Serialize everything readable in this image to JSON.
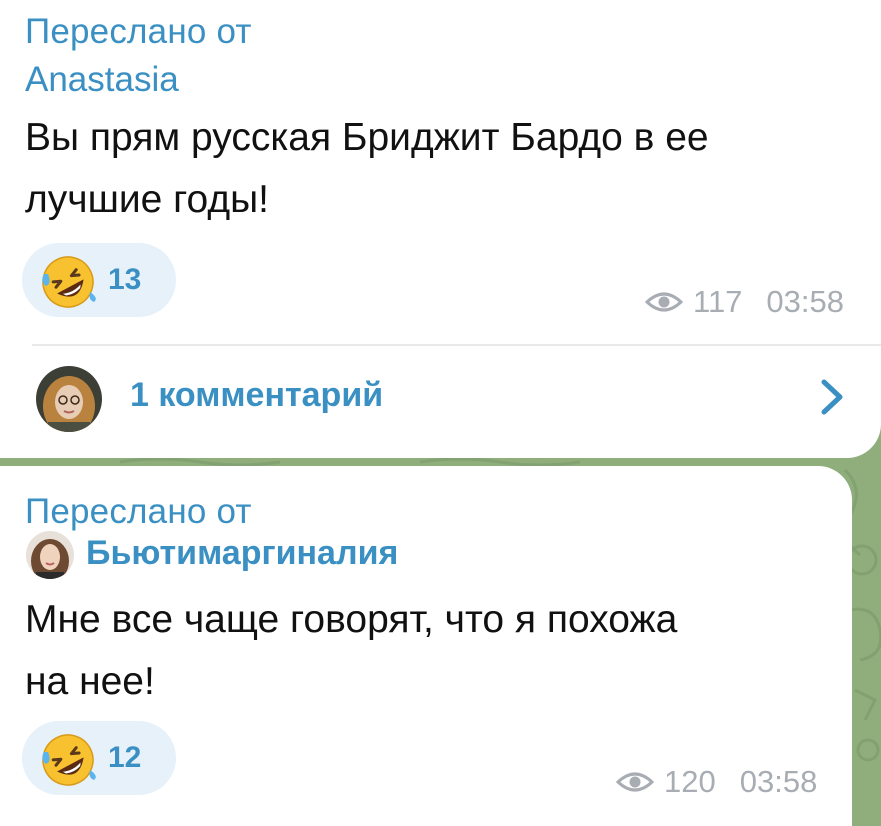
{
  "messages": [
    {
      "forwarded_label": "Переслано от",
      "forwarded_from": "Anastasia",
      "text_line1": "Вы прям русская Бриджит Бардо в ее",
      "text_line2": "лучшие годы!",
      "reaction": {
        "emoji": "rolling-on-floor-laughing",
        "count": "13"
      },
      "views": "117",
      "time": "03:58",
      "comments": "1 комментарий"
    },
    {
      "forwarded_label": "Переслано от",
      "forwarded_from": "Бьютимаргиналия",
      "text_line1": "Мне все чаще говорят, что я похожа",
      "text_line2": "на нее!",
      "reaction": {
        "emoji": "rolling-on-floor-laughing",
        "count": "12"
      },
      "views": "120",
      "time": "03:58"
    }
  ],
  "colors": {
    "accent": "#3a8fc3",
    "meta": "#a8adb3",
    "chat_background": "#8fae7c",
    "reaction_background": "#e6f1fa"
  }
}
